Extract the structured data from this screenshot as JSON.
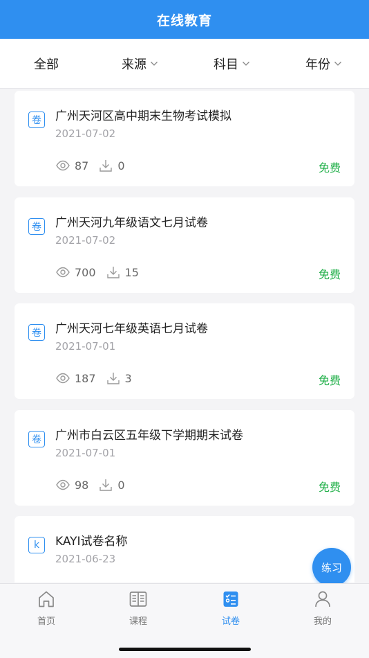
{
  "header": {
    "title": "在线教育"
  },
  "filters": {
    "all": "全部",
    "source": "来源",
    "subject": "科目",
    "year": "年份"
  },
  "papers": [
    {
      "badge": "卷",
      "title": "广州天河区高中期末生物考试模拟",
      "date": "2021-07-02",
      "views": "87",
      "downloads": "0",
      "price": "免费"
    },
    {
      "badge": "卷",
      "title": "广州天河九年级语文七月试卷",
      "date": "2021-07-02",
      "views": "700",
      "downloads": "15",
      "price": "免费"
    },
    {
      "badge": "卷",
      "title": "广州天河七年级英语七月试卷",
      "date": "2021-07-01",
      "views": "187",
      "downloads": "3",
      "price": "免费"
    },
    {
      "badge": "卷",
      "title": "广州市白云区五年级下学期期末试卷",
      "date": "2021-07-01",
      "views": "98",
      "downloads": "0",
      "price": "免费"
    },
    {
      "badge": "k",
      "title": "KAYI试卷名称",
      "date": "2021-06-23",
      "views": "",
      "downloads": "",
      "price": ""
    }
  ],
  "fab": {
    "label": "练习"
  },
  "tabbar": {
    "items": [
      {
        "label": "首页",
        "icon": "home-icon"
      },
      {
        "label": "课程",
        "icon": "book-icon"
      },
      {
        "label": "试卷",
        "icon": "exam-icon",
        "active": true
      },
      {
        "label": "我的",
        "icon": "user-icon"
      }
    ]
  },
  "colors": {
    "primary": "#2f8ff0",
    "free": "#22b04a"
  }
}
